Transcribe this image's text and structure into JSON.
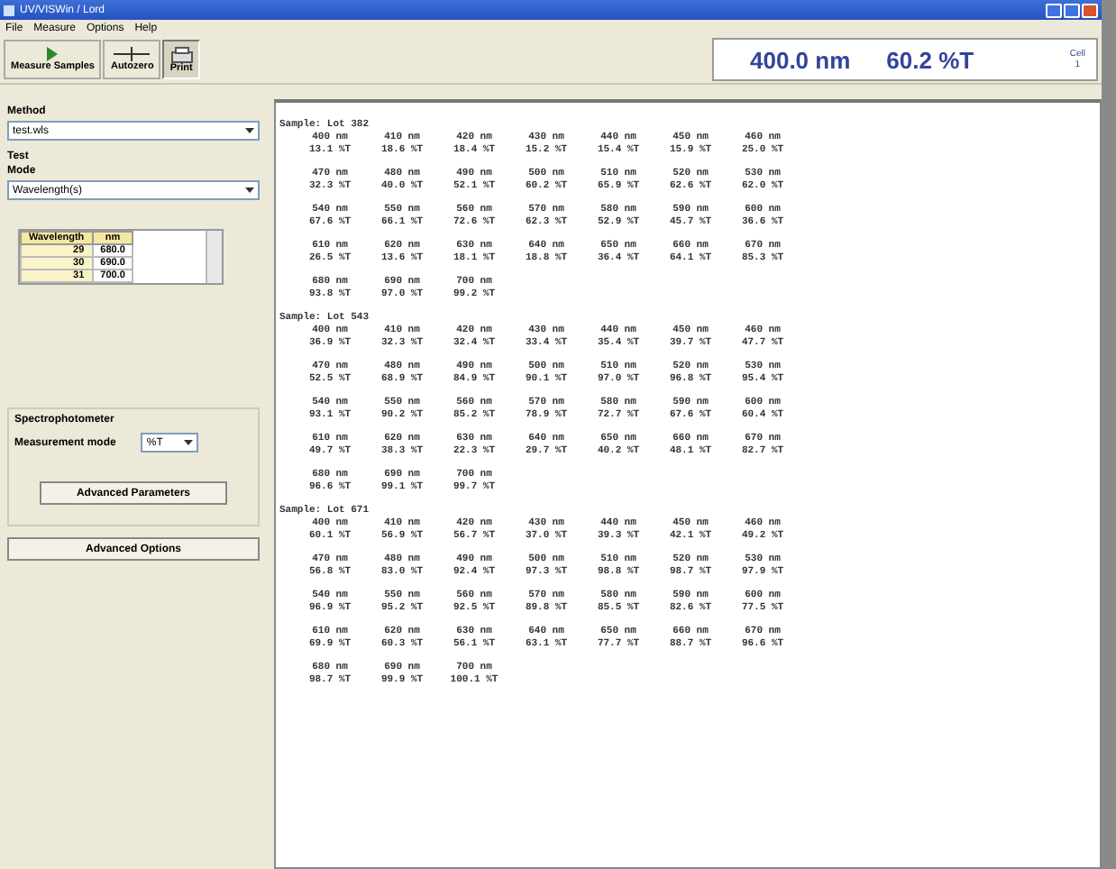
{
  "window": {
    "title": "UV/VISWin / Lord"
  },
  "menu": [
    "File",
    "Measure",
    "Options",
    "Help"
  ],
  "toolbar": [
    {
      "label": "Measure Samples",
      "kind": "play"
    },
    {
      "label": "Autozero",
      "kind": "zero"
    },
    {
      "label": "Print",
      "kind": "print"
    }
  ],
  "readout": {
    "wavelength": "400.0 nm",
    "value": "60.2 %T",
    "cell_label": "Cell",
    "cell": "1"
  },
  "method": {
    "label": "Method",
    "value": "test.wls"
  },
  "test": {
    "title": "Test",
    "mode_label": "Mode",
    "mode": "Wavelength(s)",
    "table": {
      "columns": [
        "Wavelength",
        "nm"
      ],
      "rows": [
        [
          "29",
          "680.0"
        ],
        [
          "30",
          "690.0"
        ],
        [
          "31",
          "700.0"
        ]
      ]
    }
  },
  "spectrophotometer": {
    "title": "Spectrophotometer",
    "mode_label": "Measurement mode",
    "mode": "%T",
    "button": "Advanced Parameters"
  },
  "advanced_button": "Advanced Options",
  "samples": [
    {
      "title": "Sample: Lot 382",
      "readings": [
        [
          "400 nm",
          "13.1 %T"
        ],
        [
          "410 nm",
          "18.6 %T"
        ],
        [
          "420 nm",
          "18.4 %T"
        ],
        [
          "430 nm",
          "15.2 %T"
        ],
        [
          "440 nm",
          "15.4 %T"
        ],
        [
          "450 nm",
          "15.9 %T"
        ],
        [
          "460 nm",
          "25.0 %T"
        ],
        [
          "470 nm",
          "32.3 %T"
        ],
        [
          "480 nm",
          "40.0 %T"
        ],
        [
          "490 nm",
          "52.1 %T"
        ],
        [
          "500 nm",
          "60.2 %T"
        ],
        [
          "510 nm",
          "65.9 %T"
        ],
        [
          "520 nm",
          "62.6 %T"
        ],
        [
          "530 nm",
          "62.0 %T"
        ],
        [
          "540 nm",
          "67.6 %T"
        ],
        [
          "550 nm",
          "66.1 %T"
        ],
        [
          "560 nm",
          "72.6 %T"
        ],
        [
          "570 nm",
          "62.3 %T"
        ],
        [
          "580 nm",
          "52.9 %T"
        ],
        [
          "590 nm",
          "45.7 %T"
        ],
        [
          "600 nm",
          "36.6 %T"
        ],
        [
          "610 nm",
          "26.5 %T"
        ],
        [
          "620 nm",
          "13.6 %T"
        ],
        [
          "630 nm",
          "18.1 %T"
        ],
        [
          "640 nm",
          "18.8 %T"
        ],
        [
          "650 nm",
          "36.4 %T"
        ],
        [
          "660 nm",
          "64.1 %T"
        ],
        [
          "670 nm",
          "85.3 %T"
        ],
        [
          "680 nm",
          "93.8 %T"
        ],
        [
          "690 nm",
          "97.0 %T"
        ],
        [
          "700 nm",
          "99.2 %T"
        ]
      ]
    },
    {
      "title": "Sample: Lot 543",
      "readings": [
        [
          "400 nm",
          "36.9 %T"
        ],
        [
          "410 nm",
          "32.3 %T"
        ],
        [
          "420 nm",
          "32.4 %T"
        ],
        [
          "430 nm",
          "33.4 %T"
        ],
        [
          "440 nm",
          "35.4 %T"
        ],
        [
          "450 nm",
          "39.7 %T"
        ],
        [
          "460 nm",
          "47.7 %T"
        ],
        [
          "470 nm",
          "52.5 %T"
        ],
        [
          "480 nm",
          "68.9 %T"
        ],
        [
          "490 nm",
          "84.9 %T"
        ],
        [
          "500 nm",
          "90.1 %T"
        ],
        [
          "510 nm",
          "97.0 %T"
        ],
        [
          "520 nm",
          "96.8 %T"
        ],
        [
          "530 nm",
          "95.4 %T"
        ],
        [
          "540 nm",
          "93.1 %T"
        ],
        [
          "550 nm",
          "90.2 %T"
        ],
        [
          "560 nm",
          "85.2 %T"
        ],
        [
          "570 nm",
          "78.9 %T"
        ],
        [
          "580 nm",
          "72.7 %T"
        ],
        [
          "590 nm",
          "67.6 %T"
        ],
        [
          "600 nm",
          "60.4 %T"
        ],
        [
          "610 nm",
          "49.7 %T"
        ],
        [
          "620 nm",
          "38.3 %T"
        ],
        [
          "630 nm",
          "22.3 %T"
        ],
        [
          "640 nm",
          "29.7 %T"
        ],
        [
          "650 nm",
          "40.2 %T"
        ],
        [
          "660 nm",
          "48.1 %T"
        ],
        [
          "670 nm",
          "82.7 %T"
        ],
        [
          "680 nm",
          "96.6 %T"
        ],
        [
          "690 nm",
          "99.1 %T"
        ],
        [
          "700 nm",
          "99.7 %T"
        ]
      ]
    },
    {
      "title": "Sample: Lot 671",
      "readings": [
        [
          "400 nm",
          "60.1 %T"
        ],
        [
          "410 nm",
          "56.9 %T"
        ],
        [
          "420 nm",
          "56.7 %T"
        ],
        [
          "430 nm",
          "37.0 %T"
        ],
        [
          "440 nm",
          "39.3 %T"
        ],
        [
          "450 nm",
          "42.1 %T"
        ],
        [
          "460 nm",
          "49.2 %T"
        ],
        [
          "470 nm",
          "56.8 %T"
        ],
        [
          "480 nm",
          "83.0 %T"
        ],
        [
          "490 nm",
          "92.4 %T"
        ],
        [
          "500 nm",
          "97.3 %T"
        ],
        [
          "510 nm",
          "98.8 %T"
        ],
        [
          "520 nm",
          "98.7 %T"
        ],
        [
          "530 nm",
          "97.9 %T"
        ],
        [
          "540 nm",
          "96.9 %T"
        ],
        [
          "550 nm",
          "95.2 %T"
        ],
        [
          "560 nm",
          "92.5 %T"
        ],
        [
          "570 nm",
          "89.8 %T"
        ],
        [
          "580 nm",
          "85.5 %T"
        ],
        [
          "590 nm",
          "82.6 %T"
        ],
        [
          "600 nm",
          "77.5 %T"
        ],
        [
          "610 nm",
          "69.9 %T"
        ],
        [
          "620 nm",
          "60.3 %T"
        ],
        [
          "630 nm",
          "56.1 %T"
        ],
        [
          "640 nm",
          "63.1 %T"
        ],
        [
          "650 nm",
          "77.7 %T"
        ],
        [
          "660 nm",
          "88.7 %T"
        ],
        [
          "670 nm",
          "96.6 %T"
        ],
        [
          "680 nm",
          "98.7 %T"
        ],
        [
          "690 nm",
          "99.9 %T"
        ],
        [
          "700 nm",
          "100.1 %T"
        ]
      ]
    }
  ]
}
